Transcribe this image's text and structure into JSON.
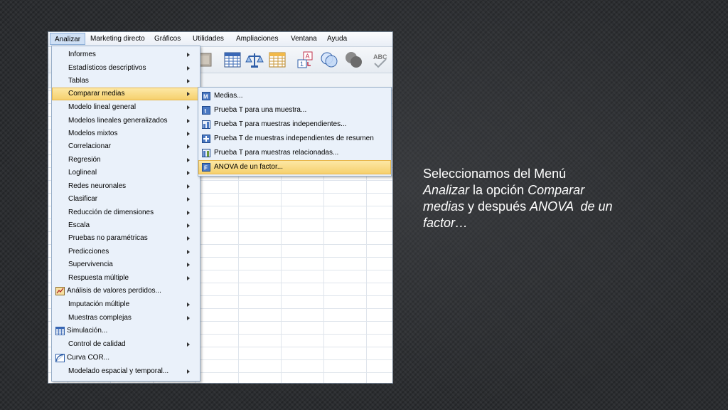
{
  "menubar": {
    "items": [
      "Analizar",
      "Marketing directo",
      "Gráficos",
      "Utilidades",
      "Ampliaciones",
      "Ventana",
      "Ayuda"
    ]
  },
  "toolbar": {
    "icons": [
      "image-icon",
      "data-grid-icon",
      "balance-scale-icon",
      "table-icon",
      "value-labels-icon",
      "venn-circles-icon",
      "circles-icon",
      "spellcheck-icon"
    ]
  },
  "analizar_menu": {
    "items": [
      {
        "label": "Informes",
        "submenu": true
      },
      {
        "label": "Estadísticos descriptivos",
        "submenu": true
      },
      {
        "label": "Tablas",
        "submenu": true
      },
      {
        "label": "Comparar medias",
        "submenu": true,
        "selected": true
      },
      {
        "label": "Modelo lineal general",
        "submenu": true
      },
      {
        "label": "Modelos lineales generalizados",
        "submenu": true
      },
      {
        "label": "Modelos mixtos",
        "submenu": true
      },
      {
        "label": "Correlacionar",
        "submenu": true
      },
      {
        "label": "Regresión",
        "submenu": true
      },
      {
        "label": "Loglineal",
        "submenu": true
      },
      {
        "label": "Redes neuronales",
        "submenu": true
      },
      {
        "label": "Clasificar",
        "submenu": true
      },
      {
        "label": "Reducción de dimensiones",
        "submenu": true
      },
      {
        "label": "Escala",
        "submenu": true
      },
      {
        "label": "Pruebas no paramétricas",
        "submenu": true
      },
      {
        "label": "Predicciones",
        "submenu": true
      },
      {
        "label": "Supervivencia",
        "submenu": true
      },
      {
        "label": "Respuesta múltiple",
        "submenu": true
      },
      {
        "label": "Análisis de valores perdidos...",
        "submenu": false,
        "icon": "missing-values-icon"
      },
      {
        "label": "Imputación múltiple",
        "submenu": true
      },
      {
        "label": "Muestras complejas",
        "submenu": true
      },
      {
        "label": "Simulación...",
        "submenu": false,
        "icon": "simulation-icon"
      },
      {
        "label": "Control de calidad",
        "submenu": true
      },
      {
        "label": "Curva COR...",
        "submenu": false,
        "icon": "roc-curve-icon"
      },
      {
        "label": "Modelado espacial y temporal...",
        "submenu": true
      }
    ]
  },
  "comparar_submenu": {
    "items": [
      {
        "label": "Medias...",
        "icon": "means-icon"
      },
      {
        "label": "Prueba T para una muestra...",
        "icon": "one-sample-t-icon"
      },
      {
        "label": "Prueba T para muestras independientes...",
        "icon": "independent-t-icon"
      },
      {
        "label": "Prueba T de muestras independientes de resumen",
        "icon": "summary-t-icon"
      },
      {
        "label": "Prueba T para muestras relacionadas...",
        "icon": "paired-t-icon"
      },
      {
        "label": "ANOVA de un factor...",
        "icon": "anova-icon",
        "selected": true
      }
    ]
  },
  "caption": {
    "line1": "Seleccionamos del Menú",
    "word_analizar": "Analizar",
    "text_la_opcion": " la opción ",
    "word_comparar": "Comparar",
    "word_medias": "medias",
    "text_y_despues": " y después ",
    "word_anova": "ANOVA  de un factor…"
  },
  "colors": {
    "highlight": "#f5cf6a",
    "menu_bg": "#eaf1fa",
    "menu_border": "#98aec8"
  }
}
